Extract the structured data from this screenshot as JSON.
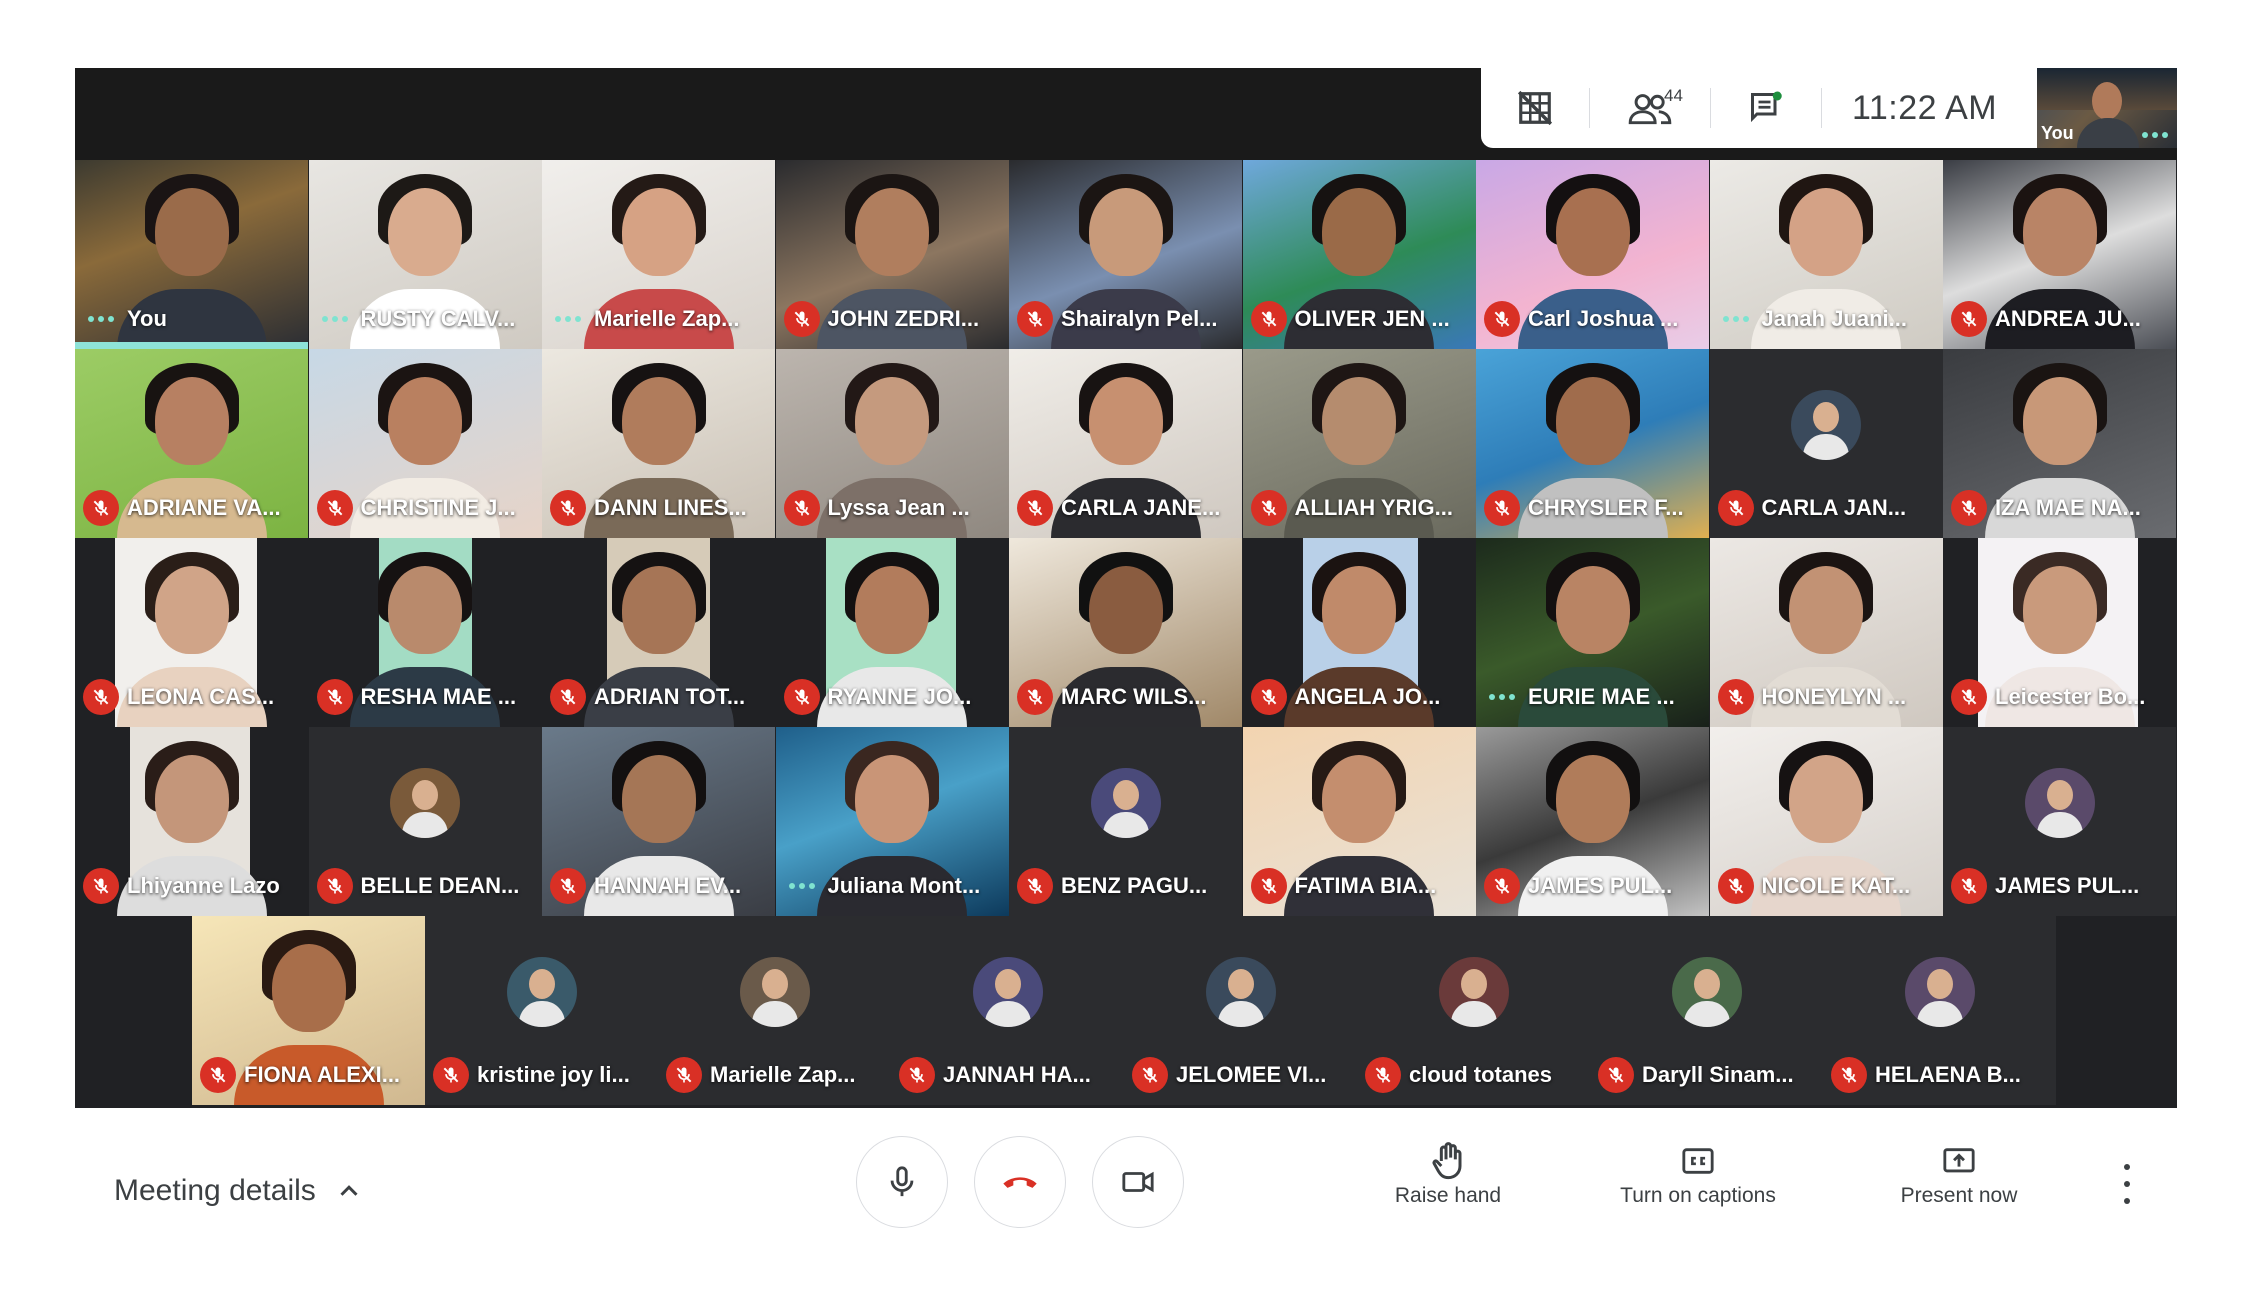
{
  "toolbar": {
    "participant_count": "44",
    "time": "11:22 AM",
    "self_label": "You"
  },
  "participants": [
    {
      "name": "You",
      "status": "talking"
    },
    {
      "name": "RUSTY CALV...",
      "status": "talking"
    },
    {
      "name": "Marielle Zap...",
      "status": "talking"
    },
    {
      "name": "JOHN ZEDRI...",
      "status": "muted"
    },
    {
      "name": "Shairalyn Pel...",
      "status": "muted"
    },
    {
      "name": "OLIVER JEN ...",
      "status": "muted"
    },
    {
      "name": "Carl Joshua ...",
      "status": "muted"
    },
    {
      "name": "Janah Juani...",
      "status": "talking"
    },
    {
      "name": "ANDREA JU...",
      "status": "muted"
    },
    {
      "name": "ADRIANE VA...",
      "status": "muted"
    },
    {
      "name": "CHRISTINE J...",
      "status": "muted"
    },
    {
      "name": "DANN LINES...",
      "status": "muted"
    },
    {
      "name": "Lyssa Jean ...",
      "status": "muted"
    },
    {
      "name": "CARLA JANE...",
      "status": "muted"
    },
    {
      "name": "ALLIAH YRIG...",
      "status": "muted"
    },
    {
      "name": "CHRYSLER F...",
      "status": "muted"
    },
    {
      "name": "CARLA JAN...",
      "status": "muted"
    },
    {
      "name": "IZA MAE NA...",
      "status": "muted"
    },
    {
      "name": "LEONA CAS...",
      "status": "muted"
    },
    {
      "name": "RESHA MAE ...",
      "status": "muted"
    },
    {
      "name": "ADRIAN TOT...",
      "status": "muted"
    },
    {
      "name": "RYANNE JO...",
      "status": "muted"
    },
    {
      "name": "MARC WILS...",
      "status": "muted"
    },
    {
      "name": "ANGELA JO...",
      "status": "muted"
    },
    {
      "name": "EURIE MAE ...",
      "status": "talking"
    },
    {
      "name": "HONEYLYN ...",
      "status": "muted"
    },
    {
      "name": "Leicester Bo...",
      "status": "muted"
    },
    {
      "name": "Lhiyanne Lazo",
      "status": "muted"
    },
    {
      "name": "BELLE DEAN...",
      "status": "muted"
    },
    {
      "name": "HANNAH EV...",
      "status": "muted"
    },
    {
      "name": "Juliana Mont...",
      "status": "talking"
    },
    {
      "name": "BENZ PAGU...",
      "status": "muted"
    },
    {
      "name": "FATIMA BIA...",
      "status": "muted"
    },
    {
      "name": "JAMES PUL...",
      "status": "muted"
    },
    {
      "name": "NICOLE KAT...",
      "status": "muted"
    },
    {
      "name": "JAMES PUL...",
      "status": "muted"
    },
    {
      "name": "FIONA ALEXI...",
      "status": "muted"
    },
    {
      "name": "kristine joy li...",
      "status": "muted"
    },
    {
      "name": "Marielle Zap...",
      "status": "muted"
    },
    {
      "name": "JANNAH HA...",
      "status": "muted"
    },
    {
      "name": "JELOMEE VI...",
      "status": "muted"
    },
    {
      "name": "cloud totanes",
      "status": "muted"
    },
    {
      "name": "Daryll Sinam...",
      "status": "muted"
    },
    {
      "name": "HELAENA B...",
      "status": "muted"
    }
  ],
  "bottom": {
    "meeting_details": "Meeting details",
    "raise_hand": "Raise hand",
    "captions": "Turn on captions",
    "present": "Present now"
  }
}
